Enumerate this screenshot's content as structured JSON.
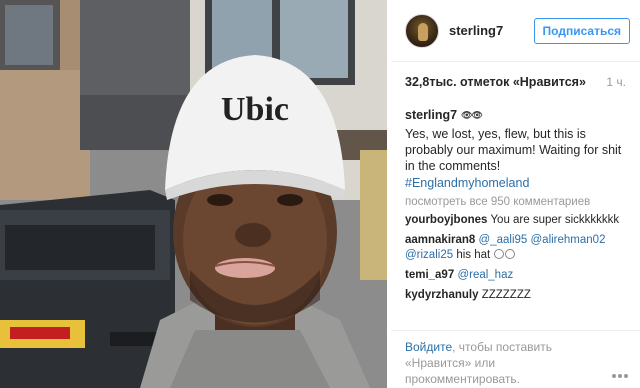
{
  "post": {
    "photo_cap_text": "Ubic"
  },
  "header": {
    "username": "sterling7",
    "follow_label": "Подписаться"
  },
  "meta": {
    "likes": "32,8тыс. отметок «Нравится»",
    "time": "1 ч."
  },
  "caption": {
    "username": "sterling7",
    "eyes": "👁👁",
    "text": "Yes, we lost, yes, flew, but this is probably our maximum! Waiting for shit in the comments!",
    "hashtag": "#Englandmyhomeland"
  },
  "view_all": "посмотреть все 950 комментариев",
  "comments": [
    {
      "user": "yourboyjbones",
      "text": "You are super sickkkkkkk"
    },
    {
      "user": "aamnakiran8",
      "mentions": [
        "@_aali95",
        "@alirehman02",
        "@rizali25"
      ],
      "text": "his hat"
    },
    {
      "user": "temi_a97",
      "mentions": [
        "@real_haz"
      ],
      "text": ""
    },
    {
      "user": "kydyrzhanuly",
      "text": "ZZZZZZZ"
    }
  ],
  "footer": {
    "login_link": "Войдите",
    "login_rest": ", чтобы поставить",
    "line2_link": "«Нравится»",
    "line2_rest": " или",
    "line3": "прокомментировать."
  },
  "colors": {
    "link": "#2d6fa7",
    "follow": "#3897f0",
    "muted": "#999999"
  }
}
